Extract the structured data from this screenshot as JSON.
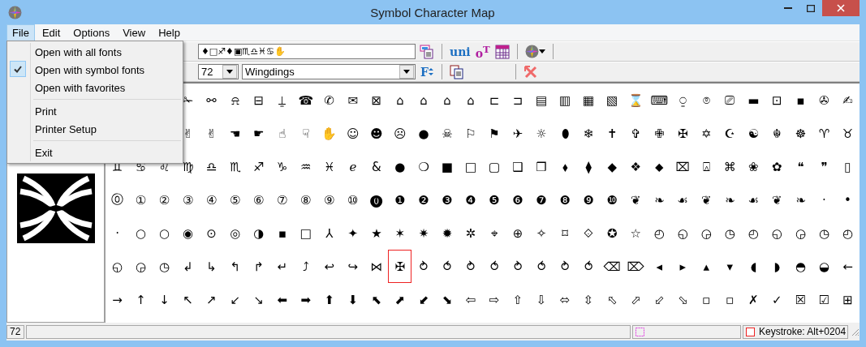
{
  "window": {
    "title": "Symbol Character Map"
  },
  "menu_bar": [
    {
      "label": "File",
      "selected": true
    },
    {
      "label": "Edit",
      "selected": false
    },
    {
      "label": "Options",
      "selected": false
    },
    {
      "label": "View",
      "selected": false
    },
    {
      "label": "Help",
      "selected": false
    }
  ],
  "open_menu": [
    {
      "kind": "item",
      "label": "Open with all fonts",
      "checked": false
    },
    {
      "kind": "item",
      "label": "Open with symbol fonts",
      "checked": true
    },
    {
      "kind": "item",
      "label": "Open with favorites",
      "checked": false
    },
    {
      "kind": "separator"
    },
    {
      "kind": "item",
      "label": "Print",
      "checked": false
    },
    {
      "kind": "item",
      "label": "Printer Setup",
      "checked": false
    },
    {
      "kind": "separator"
    },
    {
      "kind": "item",
      "label": "Exit",
      "checked": false
    }
  ],
  "toolbar_1": {
    "sample_text": "♦□♐♦▣♏♎♓♋✋",
    "unicode_button": "uni",
    "opentype_button": "o$^{T}$"
  },
  "toolbar_2": {
    "size": "72",
    "font": "Wingdings",
    "font_size_button": "F"
  },
  "grid": [
    {
      "cells": [
        {
          "char": "✁",
          "selected": false
        },
        {
          "char": "⚯",
          "selected": false
        },
        {
          "char": "⍾",
          "selected": false
        },
        {
          "char": "⊟",
          "selected": false
        },
        {
          "char": "⍊",
          "selected": false
        },
        {
          "char": "☎",
          "selected": false
        },
        {
          "char": "✆",
          "selected": false
        },
        {
          "char": "✉",
          "selected": false
        },
        {
          "char": "⊠",
          "selected": false
        },
        {
          "char": "⌂",
          "selected": false
        },
        {
          "char": "⌂",
          "selected": false
        },
        {
          "char": "⌂",
          "selected": false
        },
        {
          "char": "⌂",
          "selected": false
        },
        {
          "char": "⊏",
          "selected": false
        },
        {
          "char": "⊐",
          "selected": false
        },
        {
          "char": "▤",
          "selected": false
        },
        {
          "char": "▥",
          "selected": false
        },
        {
          "char": "▦",
          "selected": false
        },
        {
          "char": "▧",
          "selected": false
        },
        {
          "char": "⌛",
          "selected": false
        },
        {
          "char": "⌨",
          "selected": false
        },
        {
          "char": "⍜",
          "selected": false
        },
        {
          "char": "⌾",
          "selected": false
        },
        {
          "char": "⎚",
          "selected": false
        },
        {
          "char": "▬",
          "selected": false
        },
        {
          "char": "⊡",
          "selected": false
        },
        {
          "char": "▪",
          "selected": false
        },
        {
          "char": "✇",
          "selected": false
        },
        {
          "char": "✍",
          "selected": false
        }
      ]
    },
    {
      "cells": [
        {
          "char": "✌",
          "selected": false
        },
        {
          "char": "✌",
          "selected": false
        },
        {
          "char": "☚",
          "selected": false
        },
        {
          "char": "☛",
          "selected": false
        },
        {
          "char": "☝",
          "selected": false
        },
        {
          "char": "☟",
          "selected": false
        },
        {
          "char": "✋",
          "selected": false
        },
        {
          "char": "☺",
          "selected": false
        },
        {
          "char": "☻",
          "selected": false
        },
        {
          "char": "☹",
          "selected": false
        },
        {
          "char": "●",
          "selected": false
        },
        {
          "char": "☠",
          "selected": false
        },
        {
          "char": "⚐",
          "selected": false
        },
        {
          "char": "⚑",
          "selected": false
        },
        {
          "char": "✈",
          "selected": false
        },
        {
          "char": "☼",
          "selected": false
        },
        {
          "char": "⬮",
          "selected": false
        },
        {
          "char": "❄",
          "selected": false
        },
        {
          "char": "✝",
          "selected": false
        },
        {
          "char": "✞",
          "selected": false
        },
        {
          "char": "✙",
          "selected": false
        },
        {
          "char": "✠",
          "selected": false
        },
        {
          "char": "✡",
          "selected": false
        },
        {
          "char": "☪",
          "selected": false
        },
        {
          "char": "☯",
          "selected": false
        },
        {
          "char": "☬",
          "selected": false
        },
        {
          "char": "☸",
          "selected": false
        },
        {
          "char": "♈",
          "selected": false
        },
        {
          "char": "♉",
          "selected": false
        }
      ]
    },
    {
      "cells": [
        {
          "char": "♊",
          "selected": false
        },
        {
          "char": "♋",
          "selected": false
        },
        {
          "char": "♌",
          "selected": false
        },
        {
          "char": "♍",
          "selected": false
        },
        {
          "char": "♎",
          "selected": false
        },
        {
          "char": "♏",
          "selected": false
        },
        {
          "char": "♐",
          "selected": false
        },
        {
          "char": "♑",
          "selected": false
        },
        {
          "char": "♒",
          "selected": false
        },
        {
          "char": "♓",
          "selected": false
        },
        {
          "char": "ℯ",
          "selected": false
        },
        {
          "char": "&",
          "selected": false
        },
        {
          "char": "●",
          "selected": false
        },
        {
          "char": "❍",
          "selected": false
        },
        {
          "char": "■",
          "selected": false
        },
        {
          "char": "□",
          "selected": false
        },
        {
          "char": "▢",
          "selected": false
        },
        {
          "char": "❑",
          "selected": false
        },
        {
          "char": "❒",
          "selected": false
        },
        {
          "char": "⬧",
          "selected": false
        },
        {
          "char": "⧫",
          "selected": false
        },
        {
          "char": "◆",
          "selected": false
        },
        {
          "char": "❖",
          "selected": false
        },
        {
          "char": "⬥",
          "selected": false
        },
        {
          "char": "⌧",
          "selected": false
        },
        {
          "char": "⍓",
          "selected": false
        },
        {
          "char": "⌘",
          "selected": false
        },
        {
          "char": "❀",
          "selected": false
        },
        {
          "char": "✿",
          "selected": false
        },
        {
          "char": "❝",
          "selected": false
        },
        {
          "char": "❞",
          "selected": false
        },
        {
          "char": "▯",
          "selected": false
        }
      ]
    },
    {
      "cells": [
        {
          "char": "⓪",
          "selected": false
        },
        {
          "char": "①",
          "selected": false
        },
        {
          "char": "②",
          "selected": false
        },
        {
          "char": "③",
          "selected": false
        },
        {
          "char": "④",
          "selected": false
        },
        {
          "char": "⑤",
          "selected": false
        },
        {
          "char": "⑥",
          "selected": false
        },
        {
          "char": "⑦",
          "selected": false
        },
        {
          "char": "⑧",
          "selected": false
        },
        {
          "char": "⑨",
          "selected": false
        },
        {
          "char": "⑩",
          "selected": false
        },
        {
          "char": "⓿",
          "selected": false
        },
        {
          "char": "❶",
          "selected": false
        },
        {
          "char": "❷",
          "selected": false
        },
        {
          "char": "❸",
          "selected": false
        },
        {
          "char": "❹",
          "selected": false
        },
        {
          "char": "❺",
          "selected": false
        },
        {
          "char": "❻",
          "selected": false
        },
        {
          "char": "❼",
          "selected": false
        },
        {
          "char": "❽",
          "selected": false
        },
        {
          "char": "❾",
          "selected": false
        },
        {
          "char": "❿",
          "selected": false
        },
        {
          "char": "❦",
          "selected": false
        },
        {
          "char": "❧",
          "selected": false
        },
        {
          "char": "☙",
          "selected": false
        },
        {
          "char": "❦",
          "selected": false
        },
        {
          "char": "❧",
          "selected": false
        },
        {
          "char": "☙",
          "selected": false
        },
        {
          "char": "❦",
          "selected": false
        },
        {
          "char": "❧",
          "selected": false
        },
        {
          "char": "·",
          "selected": false
        },
        {
          "char": "•",
          "selected": false
        }
      ]
    },
    {
      "cells": [
        {
          "char": "·",
          "selected": false
        },
        {
          "char": "○",
          "selected": false
        },
        {
          "char": "○",
          "selected": false
        },
        {
          "char": "◉",
          "selected": false
        },
        {
          "char": "⊙",
          "selected": false
        },
        {
          "char": "◎",
          "selected": false
        },
        {
          "char": "◑",
          "selected": false
        },
        {
          "char": "▪",
          "selected": false
        },
        {
          "char": "□",
          "selected": false
        },
        {
          "char": "⅄",
          "selected": false
        },
        {
          "char": "✦",
          "selected": false
        },
        {
          "char": "★",
          "selected": false
        },
        {
          "char": "✶",
          "selected": false
        },
        {
          "char": "✷",
          "selected": false
        },
        {
          "char": "✹",
          "selected": false
        },
        {
          "char": "✲",
          "selected": false
        },
        {
          "char": "⌖",
          "selected": false
        },
        {
          "char": "⊕",
          "selected": false
        },
        {
          "char": "✧",
          "selected": false
        },
        {
          "char": "⌑",
          "selected": false
        },
        {
          "char": "⟐",
          "selected": false
        },
        {
          "char": "✪",
          "selected": false
        },
        {
          "char": "☆",
          "selected": false
        },
        {
          "char": "◴",
          "selected": false
        },
        {
          "char": "◵",
          "selected": false
        },
        {
          "char": "◶",
          "selected": false
        },
        {
          "char": "◷",
          "selected": false
        },
        {
          "char": "◴",
          "selected": false
        },
        {
          "char": "◵",
          "selected": false
        },
        {
          "char": "◶",
          "selected": false
        },
        {
          "char": "◷",
          "selected": false
        },
        {
          "char": "◴",
          "selected": false
        }
      ]
    },
    {
      "cells": [
        {
          "char": "◵",
          "selected": false
        },
        {
          "char": "◶",
          "selected": false
        },
        {
          "char": "◷",
          "selected": false
        },
        {
          "char": "↲",
          "selected": false
        },
        {
          "char": "↳",
          "selected": false
        },
        {
          "char": "↰",
          "selected": false
        },
        {
          "char": "↱",
          "selected": false
        },
        {
          "char": "↵",
          "selected": false
        },
        {
          "char": "⤴",
          "selected": false
        },
        {
          "char": "↩",
          "selected": false
        },
        {
          "char": "↪",
          "selected": false
        },
        {
          "char": "⋈",
          "selected": false
        },
        {
          "char": "✠",
          "selected": true
        },
        {
          "char": "⥁",
          "selected": false
        },
        {
          "char": "⥀",
          "selected": false
        },
        {
          "char": "⥁",
          "selected": false
        },
        {
          "char": "⥀",
          "selected": false
        },
        {
          "char": "⥁",
          "selected": false
        },
        {
          "char": "⥀",
          "selected": false
        },
        {
          "char": "⥁",
          "selected": false
        },
        {
          "char": "⥀",
          "selected": false
        },
        {
          "char": "⌫",
          "selected": false
        },
        {
          "char": "⌦",
          "selected": false
        },
        {
          "char": "◂",
          "selected": false
        },
        {
          "char": "▸",
          "selected": false
        },
        {
          "char": "▴",
          "selected": false
        },
        {
          "char": "▾",
          "selected": false
        },
        {
          "char": "◖",
          "selected": false
        },
        {
          "char": "◗",
          "selected": false
        },
        {
          "char": "◓",
          "selected": false
        },
        {
          "char": "◒",
          "selected": false
        },
        {
          "char": "←",
          "selected": false
        }
      ]
    },
    {
      "cells": [
        {
          "char": "→",
          "selected": false
        },
        {
          "char": "↑",
          "selected": false
        },
        {
          "char": "↓",
          "selected": false
        },
        {
          "char": "↖",
          "selected": false
        },
        {
          "char": "↗",
          "selected": false
        },
        {
          "char": "↙",
          "selected": false
        },
        {
          "char": "↘",
          "selected": false
        },
        {
          "char": "⬅",
          "selected": false
        },
        {
          "char": "➡",
          "selected": false
        },
        {
          "char": "⬆",
          "selected": false
        },
        {
          "char": "⬇",
          "selected": false
        },
        {
          "char": "⬉",
          "selected": false
        },
        {
          "char": "⬈",
          "selected": false
        },
        {
          "char": "⬋",
          "selected": false
        },
        {
          "char": "⬊",
          "selected": false
        },
        {
          "char": "⇦",
          "selected": false
        },
        {
          "char": "⇨",
          "selected": false
        },
        {
          "char": "⇧",
          "selected": false
        },
        {
          "char": "⇩",
          "selected": false
        },
        {
          "char": "⬄",
          "selected": false
        },
        {
          "char": "⇳",
          "selected": false
        },
        {
          "char": "⬁",
          "selected": false
        },
        {
          "char": "⬀",
          "selected": false
        },
        {
          "char": "⬃",
          "selected": false
        },
        {
          "char": "⬂",
          "selected": false
        },
        {
          "char": "▫",
          "selected": false
        },
        {
          "char": "▫",
          "selected": false
        },
        {
          "char": "✗",
          "selected": false
        },
        {
          "char": "✓",
          "selected": false
        },
        {
          "char": "☒",
          "selected": false
        },
        {
          "char": "☑",
          "selected": false
        },
        {
          "char": "⊞",
          "selected": false
        }
      ]
    }
  ],
  "status_bar": {
    "size": "72",
    "keystroke": "Keystroke: Alt+0204"
  }
}
